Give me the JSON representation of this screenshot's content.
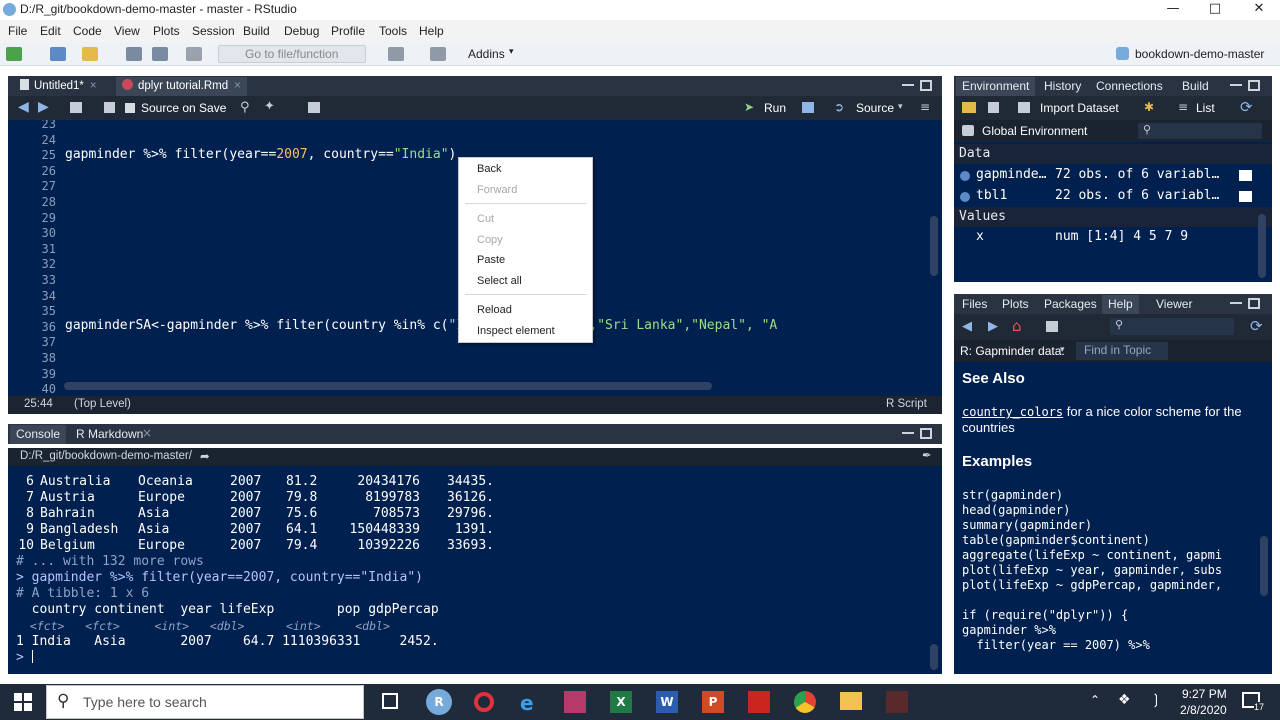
{
  "window": {
    "title": "D:/R_git/bookdown-demo-master - master - RStudio"
  },
  "menu": [
    "File",
    "Edit",
    "Code",
    "View",
    "Plots",
    "Session",
    "Build",
    "Debug",
    "Profile",
    "Tools",
    "Help"
  ],
  "toolbar": {
    "goto_placeholder": "Go to file/function",
    "addins": "Addins",
    "project": "bookdown-demo-master"
  },
  "editor": {
    "tabs": [
      {
        "label": "Untitled1*"
      },
      {
        "label": "dplyr tutorial.Rmd"
      }
    ],
    "source_on_save": "Source on Save",
    "run": "Run",
    "source": "Source",
    "line_numbers": [
      "23",
      "24",
      "25",
      "26",
      "27",
      "28",
      "29",
      "30",
      "31",
      "32",
      "33",
      "34",
      "35",
      "36",
      "37",
      "38",
      "39",
      "40"
    ],
    "line25_a": "gapminder %>% filter(year==",
    "line25_num": "2007",
    "line25_b": ", country==",
    "line25_str": "\"India\"",
    "line25_c": ")",
    "line36_a": "gapminderSA<-gapminder %>% filter(country %in% c(",
    "line36_str": "\"India\",\"Pakistan\",\"Sri Lanka\",\"Nepal\", \"A",
    "status_pos": "25:44",
    "status_level": "(Top Level)",
    "status_type": "R Script"
  },
  "context_menu": {
    "back": "Back",
    "forward": "Forward",
    "cut": "Cut",
    "copy": "Copy",
    "paste": "Paste",
    "select_all": "Select all",
    "reload": "Reload",
    "inspect": "Inspect element"
  },
  "console": {
    "tabs": [
      {
        "label": "Console"
      },
      {
        "label": "R Markdown"
      }
    ],
    "path": "D:/R_git/bookdown-demo-master/",
    "rows": [
      {
        "n": "6",
        "country": "Australia",
        "continent": "Oceania",
        "year": "2007",
        "lifeExp": "81.2",
        "pop": "20434176",
        "gdp": "34435."
      },
      {
        "n": "7",
        "country": "Austria",
        "continent": "Europe",
        "year": "2007",
        "lifeExp": "79.8",
        "pop": "8199783",
        "gdp": "36126."
      },
      {
        "n": "8",
        "country": "Bahrain",
        "continent": "Asia",
        "year": "2007",
        "lifeExp": "75.6",
        "pop": "708573",
        "gdp": "29796."
      },
      {
        "n": "9",
        "country": "Bangladesh",
        "continent": "Asia",
        "year": "2007",
        "lifeExp": "64.1",
        "pop": "150448339",
        "gdp": "1391."
      },
      {
        "n": "10",
        "country": "Belgium",
        "continent": "Europe",
        "year": "2007",
        "lifeExp": "79.4",
        "pop": "10392226",
        "gdp": "33693."
      }
    ],
    "more_rows": "# ... with 132 more rows",
    "cmd_prompt": ">",
    "cmd": "gapminder %>% filter(year==2007, country==\"India\")",
    "tibble": "# A tibble: 1 x 6",
    "header": "  country continent  year lifeExp        pop gdpPercap",
    "types": "  <fct>   <fct>     <int>   <dbl>      <int>     <dbl>",
    "result": "1 India   Asia       2007    64.7 1110396331     2452.",
    "last_prompt": ">"
  },
  "environment": {
    "tabs": [
      "Environment",
      "History",
      "Connections",
      "Build"
    ],
    "import_dataset": "Import Dataset",
    "list": "List",
    "global_env": "Global Environment",
    "data_header": "Data",
    "data": [
      {
        "name": "gapminde…",
        "desc": "72 obs. of 6 variabl…"
      },
      {
        "name": "tbl1",
        "desc": "22 obs. of 6 variabl…"
      }
    ],
    "values_header": "Values",
    "values": [
      {
        "name": "x",
        "desc": "num [1:4] 4 5 7 9"
      }
    ]
  },
  "help_pane": {
    "tabs": [
      "Files",
      "Plots",
      "Packages",
      "Help",
      "Viewer"
    ],
    "topic": "R: Gapminder data.",
    "find_in_topic": "Find in Topic",
    "see_also": "See Also",
    "link": "country_colors",
    "link_text": " for a nice color scheme for the countries",
    "examples": "Examples",
    "code": [
      "str(gapminder)",
      "head(gapminder)",
      "summary(gapminder)",
      "table(gapminder$continent)",
      "aggregate(lifeExp ~ continent, gapmi",
      "plot(lifeExp ~ year, gapminder, subs",
      "plot(lifeExp ~ gdpPercap, gapminder,",
      "",
      "if (require(\"dplyr\")) {",
      "gapminder %>%",
      "  filter(year == 2007) %>%"
    ]
  },
  "taskbar": {
    "search_placeholder": "Type here to search",
    "time": "9:27 PM",
    "date": "2/8/2020",
    "notif_count": "17"
  }
}
